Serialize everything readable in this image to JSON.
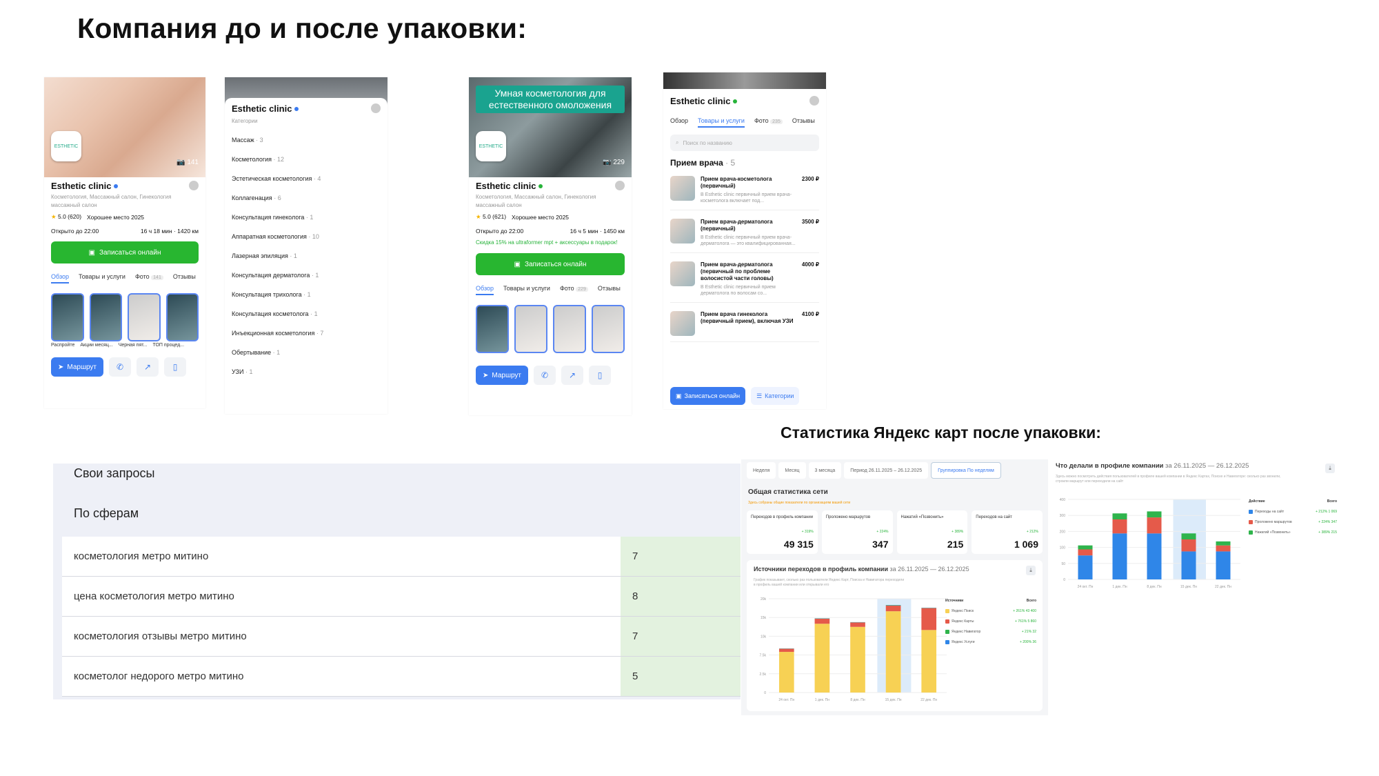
{
  "page": {
    "title": "Компания до и после упаковки:",
    "stats_title": "Статистика Яндекс карт после упаковки:"
  },
  "phone1": {
    "photo_count": "141",
    "name": "Esthetic clinic",
    "category": "Косметология, Массажный салон, Гинекология массажный салон",
    "rating": "5.0 (620)",
    "badge": "Хорошее место 2025",
    "hours": "Открыто до 22:00",
    "distance": "16 ч 18 мин · 1420 км",
    "book_label": "Записаться онлайн",
    "tabs": [
      "Обзор",
      "Товары и услуги",
      "Фото",
      "Отзывы"
    ],
    "photo_tab_count": "141",
    "thumbs": [
      "Распройте",
      "Акции месяц...",
      "Черная пят...",
      "ТОП процед..."
    ],
    "route_label": "Маршрут"
  },
  "phone2": {
    "name": "Esthetic clinic",
    "sub": "Категории",
    "items": [
      {
        "name": "Массаж",
        "n": "3"
      },
      {
        "name": "Косметология",
        "n": "12"
      },
      {
        "name": "Эстетическая косметология",
        "n": "4"
      },
      {
        "name": "Коллагенация",
        "n": "6"
      },
      {
        "name": "Консультация гинеколога",
        "n": "1"
      },
      {
        "name": "Аппаратная косметология",
        "n": "10"
      },
      {
        "name": "Лазерная эпиляция",
        "n": "1"
      },
      {
        "name": "Консультация дерматолога",
        "n": "1"
      },
      {
        "name": "Консультация трихолога",
        "n": "1"
      },
      {
        "name": "Консультация косметолога",
        "n": "1"
      },
      {
        "name": "Инъекционная косметология",
        "n": "7"
      },
      {
        "name": "Обертывание",
        "n": "1"
      },
      {
        "name": "УЗИ",
        "n": "1"
      }
    ]
  },
  "phone3": {
    "banner": "Умная косметология для естественного омоложения",
    "photo_count": "229",
    "name": "Esthetic clinic",
    "category": "Косметология, Массажный салон, Гинекология массажный салон",
    "rating": "5.0 (621)",
    "badge": "Хорошее место 2025",
    "hours": "Открыто до 22:00",
    "distance": "16 ч 5 мин · 1450 км",
    "promo": "Скидка 15% на ultraformer mpt + аксессуары в подарок!",
    "book_label": "Записаться онлайн",
    "tabs": [
      "Обзор",
      "Товары и услуги",
      "Фото",
      "Отзывы"
    ],
    "photo_tab_count": "229",
    "route_label": "Маршрут"
  },
  "phone4": {
    "name": "Esthetic clinic",
    "tabs": [
      "Обзор",
      "Товары и услуги",
      "Фото",
      "Отзывы"
    ],
    "photo_tab_count": "235",
    "search_placeholder": "Поиск по названию",
    "category": "Прием врача",
    "category_count": "5",
    "services": [
      {
        "name": "Прием врача-косметолога (первичный)",
        "desc": "В Esthetic clinic первичный прием врача-косметолога включает под...",
        "price": "2300 ₽"
      },
      {
        "name": "Прием врача-дерматолога (первичный)",
        "desc": "В Esthetic clinic первичный прием врача-дерматолога — это квалифицированная...",
        "price": "3500 ₽"
      },
      {
        "name": "Прием врача-дерматолога (первичный по проблеме волосистой части головы)",
        "desc": "В Esthetic clinic первичный прием дерматолога по волосам со...",
        "price": "4000 ₽"
      },
      {
        "name": "Прием врача гинеколога (первичный прием), включая УЗИ",
        "desc": "",
        "price": "4100 ₽"
      }
    ],
    "book_label": "Записаться онлайн",
    "categories_label": "Категории"
  },
  "queries": {
    "own_label": "Свои запросы",
    "spheres_label": "По сферам",
    "rows": [
      {
        "query": "косметология метро митино",
        "value": "7"
      },
      {
        "query": "цена косметология метро митино",
        "value": "8"
      },
      {
        "query": "косметология отзывы метро митино",
        "value": "7"
      },
      {
        "query": "косметолог недорого метро митино",
        "value": "5"
      }
    ]
  },
  "stats": {
    "tabs": [
      "Неделя",
      "Месяц",
      "3 месяца",
      "Период 26.11.2025 – 26.12.2025",
      "Группировка По неделям"
    ],
    "header": "Общая статистика сети",
    "note": "Здесь собраны общие показатели по организациям вашей сети",
    "kpis": [
      {
        "label": "Переходов в профиль компании",
        "growth": "+ 319%",
        "value": "49 315"
      },
      {
        "label": "Проложено маршрутов",
        "growth": "+ 224%",
        "value": "347"
      },
      {
        "label": "Нажатий «Позвонить»",
        "growth": "+ 389%",
        "value": "215"
      },
      {
        "label": "Переходов на сайт",
        "growth": "+ 212%",
        "value": "1 069"
      }
    ],
    "sources_title": "Источники переходов в профиль компании",
    "sources_dates": "за 26.11.2025 — 26.12.2025",
    "sources_sub": "График показывает, сколько раз пользователи Яндекс Карт, Поиска и Навигатора переходили в профиль вашей компании или открывали его",
    "legend_title": "Источники",
    "legend_total": "Всего",
    "legend": [
      {
        "name": "Яндекс Поиск",
        "growth": "+ 261% 43 400",
        "color": "#f7d154"
      },
      {
        "name": "Яндекс Карты",
        "growth": "+ 761% 5 860",
        "color": "#e55a4a"
      },
      {
        "name": "Яндекс Навигатор",
        "growth": "+ 21% 32",
        "color": "#2fb44c"
      },
      {
        "name": "Яндекс Услуги",
        "growth": "+ 200% 36",
        "color": "#2f86e8"
      }
    ],
    "x_labels": [
      "24 окт. Пн",
      "1 дек. Пн",
      "8 дек. Пн",
      "15 дек. Пн",
      "22 дек. Пн"
    ],
    "y_labels": [
      "20k",
      "15k",
      "10k",
      "7.5k",
      "2.5k",
      "0"
    ]
  },
  "actions": {
    "title": "Что делали в профиле компании",
    "dates": "за 26.11.2025 — 26.12.2025",
    "sub": "Здесь можно посмотреть действия пользователей в профиле вашей компании в Яндекс Картах, Поиске и Навигаторе: сколько раз звонили, строили маршрут или переходили на сайт",
    "legend_title": "Действие",
    "legend_total": "Всего",
    "legend": [
      {
        "name": "Переходы на сайт",
        "growth": "+ 212% 1 069",
        "color": "#2f86e8"
      },
      {
        "name": "Проложено маршрутов",
        "growth": "+ 224% 347",
        "color": "#e55a4a"
      },
      {
        "name": "Нажатий «Позвонить»",
        "growth": "+ 389% 215",
        "color": "#2fb44c"
      }
    ],
    "x_labels": [
      "24 окт. Пн",
      "1 дек. Пн",
      "8 дек. Пн",
      "15 дек. Пн",
      "22 дек. Пн"
    ],
    "y_labels": [
      "400",
      "300",
      "200",
      "100",
      "50",
      "0"
    ]
  },
  "chart_data": [
    {
      "type": "bar",
      "title": "Источники переходов в профиль компании",
      "categories": [
        "24 окт. Пн",
        "1 дек. Пн",
        "8 дек. Пн",
        "15 дек. Пн",
        "22 дек. Пн"
      ],
      "series": [
        {
          "name": "Яндекс Поиск",
          "values": [
            6500,
            11000,
            10500,
            13000,
            10000
          ]
        },
        {
          "name": "Яндекс Карты",
          "values": [
            500,
            800,
            700,
            900,
            3500
          ]
        },
        {
          "name": "Яндекс Навигатор",
          "values": [
            30,
            40,
            30,
            50,
            40
          ]
        },
        {
          "name": "Яндекс Услуги",
          "values": [
            20,
            30,
            30,
            40,
            30
          ]
        }
      ],
      "ylim": [
        0,
        15000
      ],
      "stacked": true
    },
    {
      "type": "bar",
      "title": "Что делали в профиле компании",
      "categories": [
        "24 окт. Пн",
        "1 дек. Пн",
        "8 дек. Пн",
        "15 дек. Пн",
        "22 дек. Пн"
      ],
      "series": [
        {
          "name": "Переходы на сайт",
          "values": [
            120,
            230,
            230,
            140,
            140
          ]
        },
        {
          "name": "Проложено маршрутов",
          "values": [
            30,
            70,
            80,
            60,
            30
          ]
        },
        {
          "name": "Нажатий «Позвонить»",
          "values": [
            20,
            30,
            30,
            30,
            20
          ]
        }
      ],
      "ylim": [
        0,
        400
      ],
      "stacked": true
    }
  ]
}
